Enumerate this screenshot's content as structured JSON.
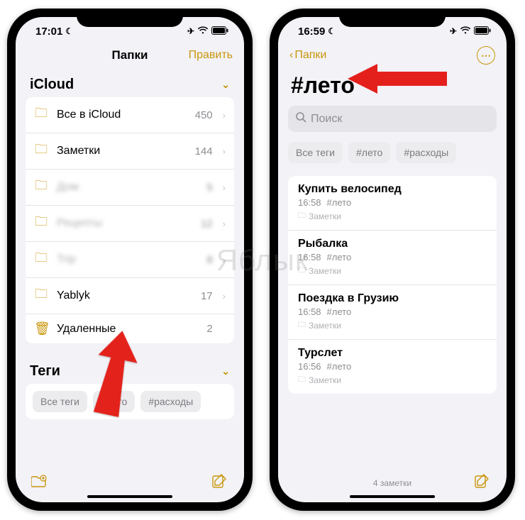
{
  "watermark": "Яблык",
  "left": {
    "status": {
      "time": "17:01"
    },
    "nav": {
      "title": "Папки",
      "edit": "Править"
    },
    "icloud": {
      "header": "iCloud",
      "rows": [
        {
          "label": "Все в iCloud",
          "count": "450",
          "blur": false
        },
        {
          "label": "Заметки",
          "count": "144",
          "blur": false
        },
        {
          "label": "Дом",
          "count": "5",
          "blur": true
        },
        {
          "label": "Рецепты",
          "count": "12",
          "blur": true
        },
        {
          "label": "Trip",
          "count": "8",
          "blur": true
        },
        {
          "label": "Yablyk",
          "count": "17",
          "blur": false
        }
      ],
      "deleted": {
        "label": "Удаленные",
        "count": "2"
      }
    },
    "tags": {
      "header": "Теги",
      "items": [
        "Все теги",
        "#лето",
        "#расходы"
      ]
    }
  },
  "right": {
    "status": {
      "time": "16:59"
    },
    "nav": {
      "back": "Папки"
    },
    "title": "#лето",
    "search_placeholder": "Поиск",
    "tags": [
      "Все теги",
      "#лето",
      "#расходы"
    ],
    "notes": [
      {
        "title": "Купить велосипед",
        "time": "16:58",
        "tag": "#лето",
        "folder": "Заметки"
      },
      {
        "title": "Рыбалка",
        "time": "16:58",
        "tag": "#лето",
        "folder": "Заметки"
      },
      {
        "title": "Поездка в Грузию",
        "time": "16:58",
        "tag": "#лето",
        "folder": "Заметки"
      },
      {
        "title": "Турслет",
        "time": "16:56",
        "tag": "#лето",
        "folder": "Заметки"
      }
    ],
    "footer_count": "4 заметки"
  }
}
